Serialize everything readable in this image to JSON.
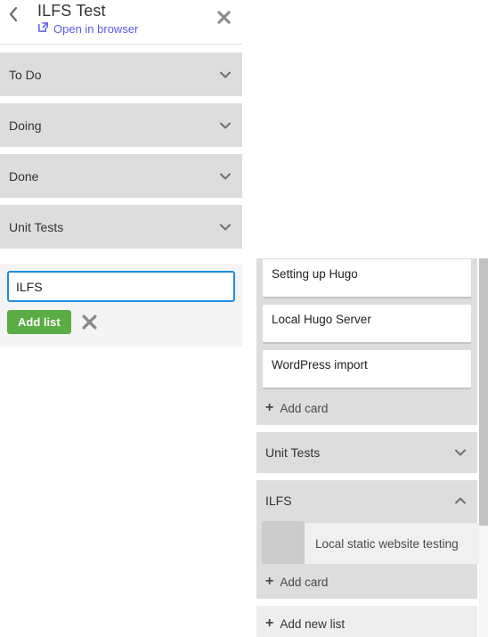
{
  "left_panel": {
    "back_icon": "chevron-left-icon",
    "title": "ILFS Test",
    "open_in_browser": {
      "icon": "external-link-icon",
      "label": "Open in browser"
    },
    "close_icon": "close-icon",
    "lists": [
      {
        "name": "To Do",
        "chevron": "chevron-down-icon"
      },
      {
        "name": "Doing",
        "chevron": "chevron-down-icon"
      },
      {
        "name": "Done",
        "chevron": "chevron-down-icon"
      },
      {
        "name": "Unit Tests",
        "chevron": "chevron-down-icon"
      }
    ],
    "add_list_form": {
      "input_value": "ILFS",
      "input_placeholder": "",
      "submit_label": "Add list",
      "cancel_icon": "close-icon"
    }
  },
  "board": {
    "cards_top": [
      {
        "title": "Setting up Hugo"
      },
      {
        "title": "Local Hugo Server"
      },
      {
        "title": "WordPress import"
      }
    ],
    "add_card_label": "Add card",
    "lists": [
      {
        "name": "Unit Tests",
        "chevron": "chevron-down-icon",
        "expanded": false
      },
      {
        "name": "ILFS",
        "chevron": "chevron-up-icon",
        "expanded": true
      }
    ],
    "dragging_card": {
      "title": "Local static website testing"
    },
    "ilfs_add_card_label": "Add card",
    "add_new_list_label": "Add new list",
    "plus_glyph": "+"
  },
  "colors": {
    "accent_blue": "#5a5ae6",
    "input_focus": "#1f8ce0",
    "button_green": "#5aac44",
    "list_gray": "#dddddd",
    "placeholder_gray": "#cccccc",
    "ghost_gray": "#f0f0f0",
    "scrollbar_thumb": "#c1c1c1"
  }
}
